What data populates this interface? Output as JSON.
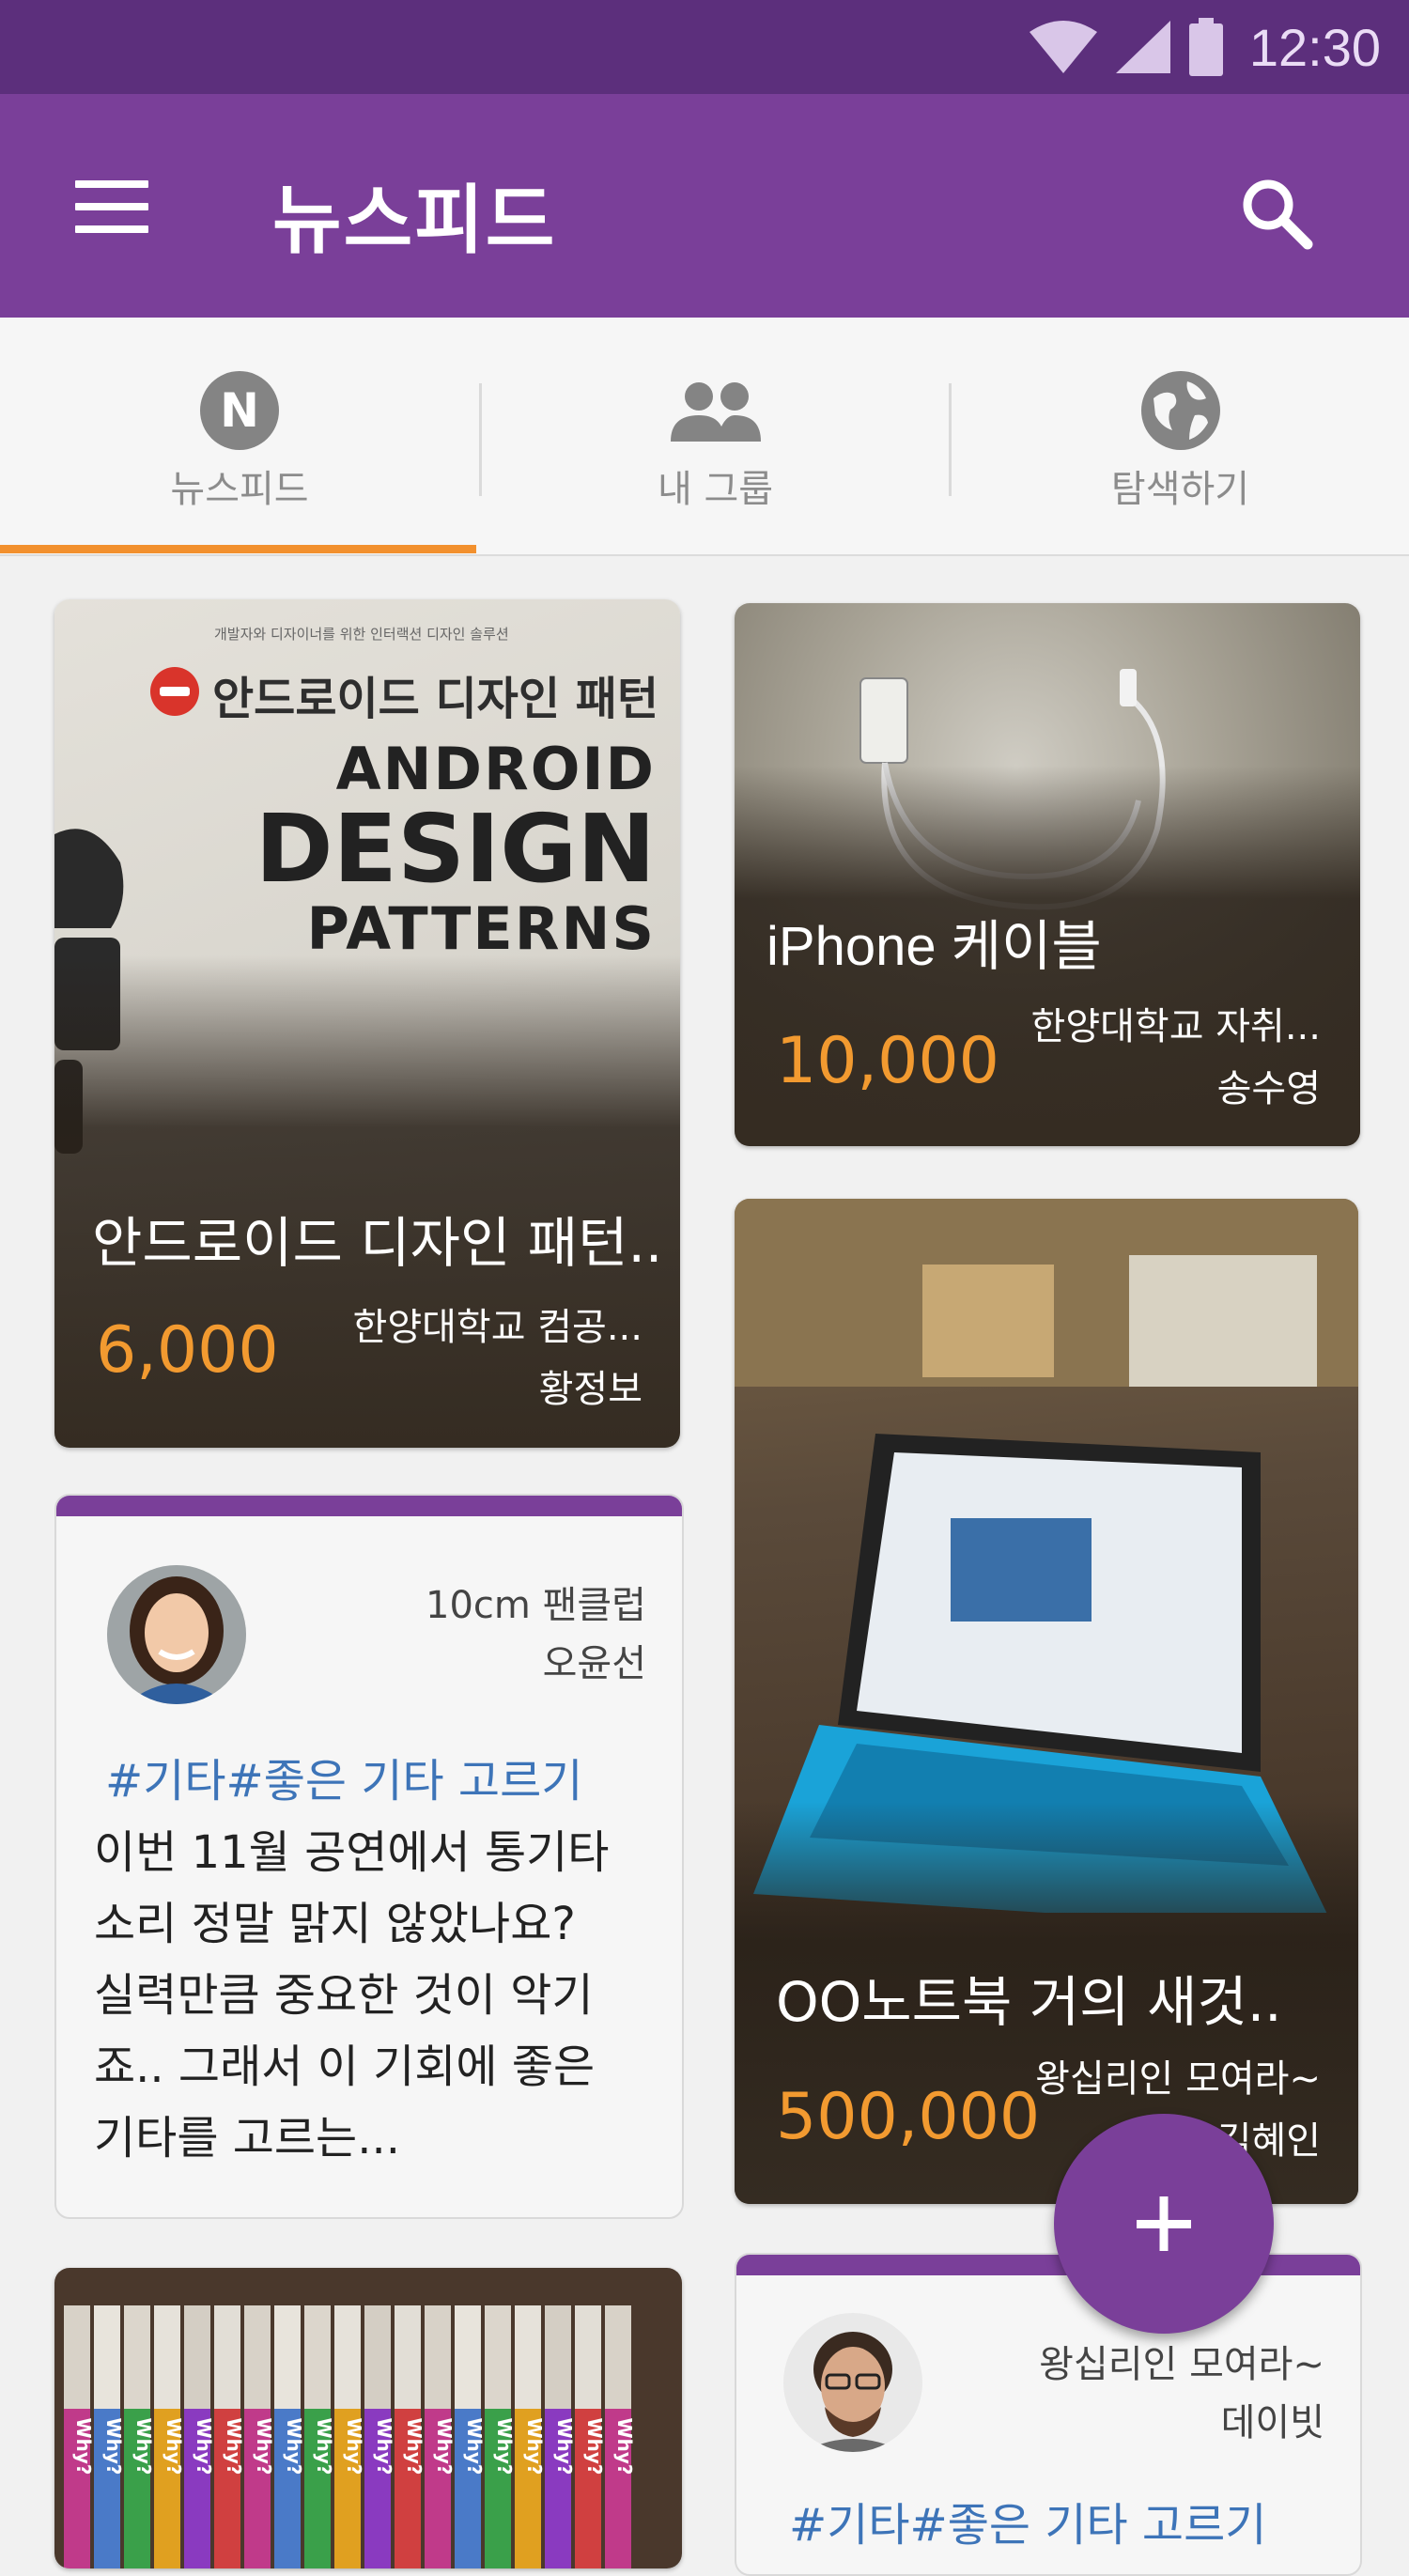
{
  "status_bar": {
    "time": "12:30",
    "icons": [
      "wifi-icon",
      "signal-icon",
      "battery-icon"
    ]
  },
  "app_bar": {
    "title": "뉴스피드",
    "menu_icon": "menu-icon",
    "search_icon": "search-icon"
  },
  "tabs": [
    {
      "label": "뉴스피드",
      "icon": "newsfeed-icon",
      "selected": true
    },
    {
      "label": "내 그룹",
      "icon": "group-icon",
      "selected": false
    },
    {
      "label": "탐색하기",
      "icon": "globe-icon",
      "selected": false
    }
  ],
  "colors": {
    "primary": "#7a3f99",
    "status_bar": "#5c2f7c",
    "accent": "#f2902e",
    "price": "#f29a30",
    "hashtag": "#3d74b8"
  },
  "feed": {
    "item1": {
      "type": "sale",
      "cover": {
        "top_line": "개발자와 디자이너를 위한 인터랙션 디자인 솔루션",
        "title_ko": "안드로이드 디자인 패턴",
        "title_en_1": "ANDROID",
        "title_en_2": "DESIGN",
        "title_en_3": "PATTERNS"
      },
      "title": "안드로이드 디자인 패턴..",
      "price": "6,000",
      "group": "한양대학교 컴공...",
      "seller": "황정보"
    },
    "item2": {
      "type": "sale",
      "title": "iPhone  케이블",
      "price": "10,000",
      "group": "한양대학교 자취...",
      "seller": "송수영"
    },
    "item3": {
      "type": "post",
      "group": "10cm 팬클럽",
      "author": "오윤선",
      "hashtags": "#기타#좋은 기타 고르기",
      "body": " 이번 11월 공연에서 통기타 소리 정말 맑지 않았나요? 실력만큼 중요한 것이 악기죠.. 그래서 이 기회에 좋은 기타를 고르는..."
    },
    "item4": {
      "type": "sale",
      "title": "OO노트북  거의 새것..",
      "price": "500,000",
      "group": "왕십리인 모여라~",
      "seller": "김혜인"
    },
    "item5": {
      "type": "post",
      "group": "왕십리인 모여라~",
      "author": "데이빗",
      "hashtags": "#기타#좋은 기타 고르기"
    },
    "item6": {
      "type": "sale",
      "cover_text": "Why?"
    }
  },
  "fab": {
    "icon": "plus-icon"
  }
}
